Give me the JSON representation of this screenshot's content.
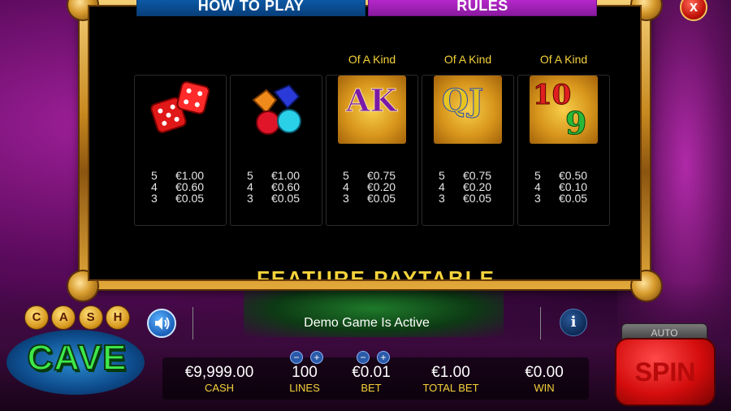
{
  "tabs": {
    "how_to_play": "HOW TO PLAY",
    "rules": "RULES",
    "close": "x"
  },
  "paytable": [
    {
      "icon": "dice",
      "header": "",
      "rows": [
        {
          "n": "5",
          "v": "€1.00"
        },
        {
          "n": "4",
          "v": "€0.60"
        },
        {
          "n": "3",
          "v": "€0.05"
        }
      ]
    },
    {
      "icon": "gems",
      "header": "",
      "rows": [
        {
          "n": "5",
          "v": "€1.00"
        },
        {
          "n": "4",
          "v": "€0.60"
        },
        {
          "n": "3",
          "v": "€0.05"
        }
      ]
    },
    {
      "icon": "ace-king",
      "header": "Of A Kind",
      "rows": [
        {
          "n": "5",
          "v": "€0.75"
        },
        {
          "n": "4",
          "v": "€0.20"
        },
        {
          "n": "3",
          "v": "€0.05"
        }
      ]
    },
    {
      "icon": "queen-jack",
      "header": "Of A Kind",
      "rows": [
        {
          "n": "5",
          "v": "€0.75"
        },
        {
          "n": "4",
          "v": "€0.20"
        },
        {
          "n": "3",
          "v": "€0.05"
        }
      ]
    },
    {
      "icon": "ten-nine",
      "header": "Of A Kind",
      "rows": [
        {
          "n": "5",
          "v": "€0.50"
        },
        {
          "n": "4",
          "v": "€0.10"
        },
        {
          "n": "3",
          "v": "€0.05"
        }
      ]
    }
  ],
  "symbols": {
    "ak": "AK",
    "qj": "QJ",
    "ten": "10",
    "nine": "9"
  },
  "feature_title": "FEATURE PAYTABLE",
  "status": "Demo Game Is Active",
  "meters": {
    "cash": {
      "value": "€9,999.00",
      "label": "CASH"
    },
    "lines": {
      "value": "100",
      "label": "LINES"
    },
    "bet": {
      "value": "€0.01",
      "label": "BET"
    },
    "total_bet": {
      "value": "€1.00",
      "label": "TOTAL BET"
    },
    "win": {
      "value": "€0.00",
      "label": "WIN"
    }
  },
  "stepper": {
    "minus": "−",
    "plus": "+"
  },
  "spin": {
    "auto": "AUTO",
    "label": "SPIN"
  },
  "logo": {
    "coins": [
      "C",
      "A",
      "S",
      "H"
    ],
    "word": "CAVE"
  },
  "icons": {
    "speaker": "speaker-icon",
    "info": "info-icon"
  },
  "colors": {
    "accent_yellow": "#f5d33b",
    "tab_blue": "#0d5fb0",
    "tab_purple": "#c02ad4",
    "spin_red": "#d40c0c"
  }
}
